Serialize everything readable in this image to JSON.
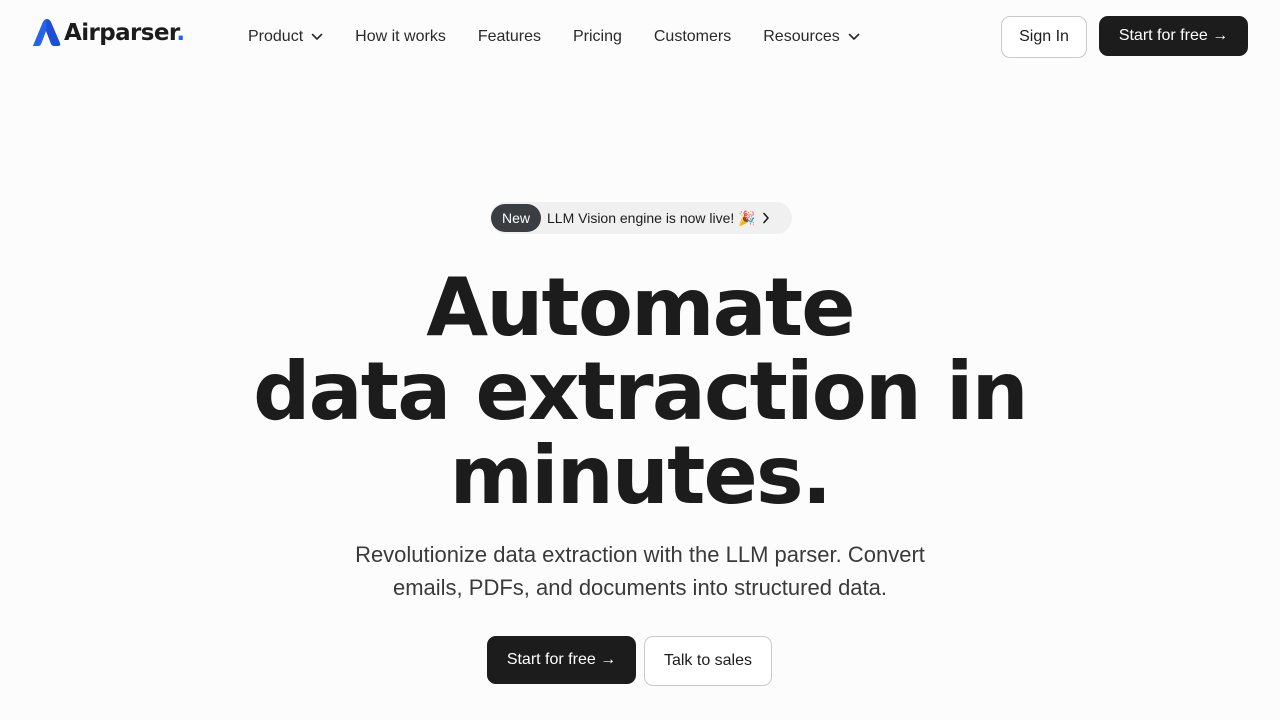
{
  "brand": {
    "name": "Airparser",
    "dot": ".",
    "accent_color": "#2563eb",
    "logo_icon": "airparser-logo-icon"
  },
  "nav": {
    "items": [
      {
        "label": "Product",
        "dropdown": true
      },
      {
        "label": "How it works",
        "dropdown": false
      },
      {
        "label": "Features",
        "dropdown": false
      },
      {
        "label": "Pricing",
        "dropdown": false
      },
      {
        "label": "Customers",
        "dropdown": false
      },
      {
        "label": "Resources",
        "dropdown": true
      }
    ],
    "sign_in": "Sign In",
    "start_free": "Start for free →"
  },
  "announcement": {
    "tag": "New",
    "text": "LLM Vision engine is now live! 🎉",
    "icon": "chevron-right-icon"
  },
  "hero": {
    "title_lines": [
      "Automate",
      "data extraction in",
      "minutes."
    ],
    "subtitle": "Revolutionize data extraction with the LLM parser. Convert emails, PDFs, and documents into structured data.",
    "cta_primary": "Start for free →",
    "cta_secondary": "Talk to sales"
  },
  "colors": {
    "dark": "#1c1c1c",
    "background": "#fcfcfc",
    "badge_tag": "#3a3d42"
  }
}
